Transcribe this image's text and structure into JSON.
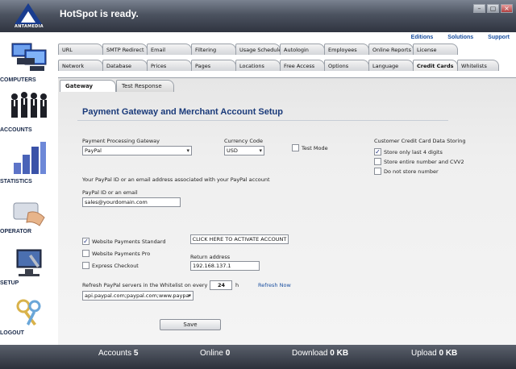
{
  "app": {
    "title": "HotSpot is ready.",
    "brand": "ANTAMEDIA",
    "window_buttons": [
      "–",
      "▢",
      "×"
    ]
  },
  "sidebar": {
    "items": [
      {
        "label": "COMPUTERS",
        "icon": "computers-icon"
      },
      {
        "label": "ACCOUNTS",
        "icon": "accounts-icon"
      },
      {
        "label": "STATISTICS",
        "icon": "statistics-icon"
      },
      {
        "label": "OPERATOR",
        "icon": "operator-icon"
      },
      {
        "label": "SETUP",
        "icon": "setup-icon"
      },
      {
        "label": "LOGOUT",
        "icon": "logout-icon"
      }
    ]
  },
  "toplinks": [
    "Editions",
    "Solutions",
    "Support"
  ],
  "tabs": {
    "row1": [
      "URL",
      "SMTP Redirect",
      "Email",
      "Filtering",
      "Usage Schedule",
      "Autologin",
      "Employees",
      "Online Reports",
      "License"
    ],
    "row2": [
      "Network",
      "Database",
      "Prices",
      "Pages",
      "Locations",
      "Free Access",
      "Options",
      "Language",
      "Credit Cards",
      "Whitelists"
    ],
    "active": "Credit Cards"
  },
  "subtabs": [
    "Gateway",
    "Test Response"
  ],
  "page": {
    "title": "Payment Gateway and Merchant Account Setup",
    "gateway_label": "Payment Processing Gateway",
    "gateway_value": "PayPal",
    "currency_label": "Currency Code",
    "currency_value": "USD",
    "test_mode": "Test Mode",
    "storing_label": "Customer Credit Card Data Storing",
    "storing_options": [
      {
        "label": "Store only last 4 digits",
        "checked": true
      },
      {
        "label": "Store entire number and CVV2",
        "checked": false
      },
      {
        "label": "Do not store number",
        "checked": false
      }
    ],
    "paypal_note": "Your PayPal ID or an email address associated with your PayPal account",
    "paypal_id_label": "PayPal ID or an email",
    "paypal_id_value": "sales@yourdomain.com",
    "payment_options": [
      {
        "label": "Website Payments Standard",
        "checked": true
      },
      {
        "label": "Website Payments Pro",
        "checked": false
      },
      {
        "label": "Express Checkout",
        "checked": false
      }
    ],
    "activate_button": "CLICK HERE TO ACTIVATE ACCOUNT",
    "return_label": "Return address",
    "return_value": "192.168.137.1",
    "refresh_label": "Refresh PayPal servers in the Whitelist on every",
    "refresh_value": "24",
    "refresh_unit": "h",
    "refresh_link": "Refresh Now",
    "servers_value": "api.paypal.com;paypal.com;www.paypa",
    "save_label": "Save"
  },
  "status": {
    "accounts_label": "Accounts",
    "accounts_value": "5",
    "online_label": "Online",
    "online_value": "0",
    "download_label": "Download",
    "download_value": "0 KB",
    "upload_label": "Upload",
    "upload_value": "0 KB"
  }
}
